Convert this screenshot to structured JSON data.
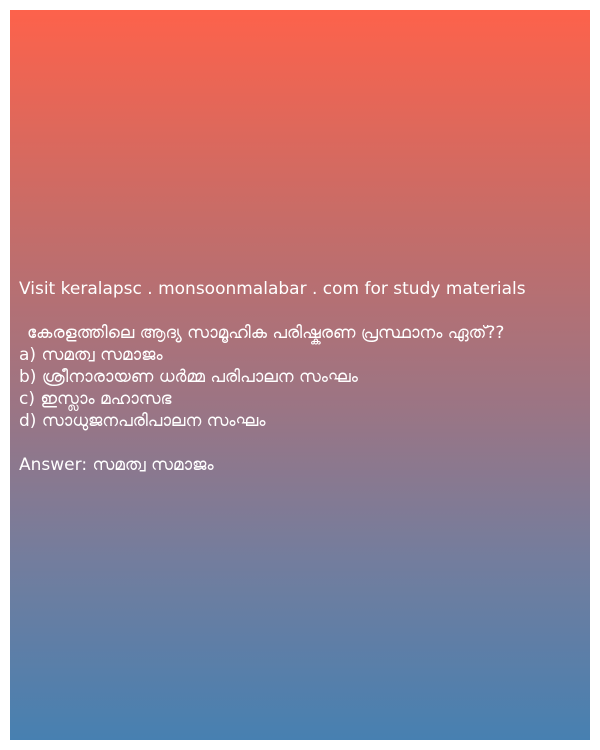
{
  "card": {
    "promo_text": "Visit keralapsc . monsoonmalabar . com for study materials",
    "question": "കേരളത്തിലെ ആദ്യ സാമൂഹിക പരിഷ്കരണ പ്രസ്ഥാനം ഏത്??",
    "options": [
      "a) സമത്വ സമാജം",
      "b) ശ്രീനാരായണ ധർമ്മ പരിപാലന സംഘം",
      "c) ഇസ്ലാം മഹാസഭ",
      "d) സാധുജനപരിപാലന സംഘം"
    ],
    "answer": "Answer: സമത്വ സമാജം"
  },
  "colors": {
    "gradient_top": "#fd624b",
    "gradient_bottom": "#4780b1",
    "text": "#ffffff"
  }
}
